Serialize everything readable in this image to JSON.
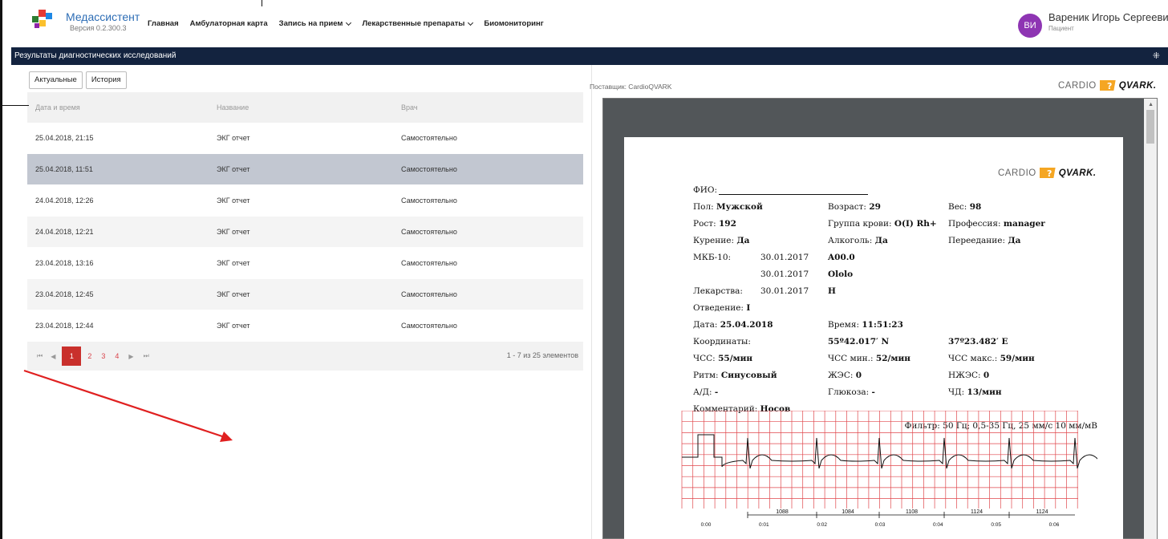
{
  "header": {
    "brand": "Медассистент",
    "version": "Версия 0.2.300.3",
    "nav": [
      {
        "label": "Главная",
        "has_dropdown": false
      },
      {
        "label": "Амбулаторная карта",
        "has_dropdown": false
      },
      {
        "label": "Запись на прием",
        "has_dropdown": true
      },
      {
        "label": "Лекарственные препараты",
        "has_dropdown": true
      },
      {
        "label": "Биомониторинг",
        "has_dropdown": false
      }
    ],
    "user": {
      "initials": "ВИ",
      "name": "Вареник Игорь Сергеевич",
      "role": "Пациент",
      "avatar_color": "#8e35b3"
    }
  },
  "panel_title": "Результаты диагностических исследований",
  "tabs": [
    {
      "label": "Актуальные"
    },
    {
      "label": "История"
    }
  ],
  "table": {
    "columns": [
      "Дата и время",
      "Название",
      "Врач"
    ],
    "rows": [
      {
        "datetime": "25.04.2018, 21:15",
        "name": "ЭКГ отчет",
        "doctor": "Самостоятельно"
      },
      {
        "datetime": "25.04.2018, 11:51",
        "name": "ЭКГ отчет",
        "doctor": "Самостоятельно",
        "selected": true
      },
      {
        "datetime": "24.04.2018, 12:26",
        "name": "ЭКГ отчет",
        "doctor": "Самостоятельно"
      },
      {
        "datetime": "24.04.2018, 12:21",
        "name": "ЭКГ отчет",
        "doctor": "Самостоятельно"
      },
      {
        "datetime": "23.04.2018, 13:16",
        "name": "ЭКГ отчет",
        "doctor": "Самостоятельно"
      },
      {
        "datetime": "23.04.2018, 12:45",
        "name": "ЭКГ отчет",
        "doctor": "Самостоятельно"
      },
      {
        "datetime": "23.04.2018, 12:44",
        "name": "ЭКГ отчет",
        "doctor": "Самостоятельно"
      }
    ]
  },
  "pager": {
    "pages": [
      "1",
      "2",
      "3",
      "4"
    ],
    "current": "1",
    "info": "1 - 7 из 25 элементов",
    "first_icon": "first-page-icon",
    "prev_icon": "prev-page-icon",
    "next_icon": "next-page-icon",
    "last_icon": "last-page-icon"
  },
  "report": {
    "provider": "Поставщик: CardioQVARK",
    "logo_left": "CARDIO",
    "logo_right": "QVARK.",
    "logo_accent": "#f5a623",
    "fio_label": "ФИО:",
    "sex_label": "Пол:",
    "sex": "Мужской",
    "age_label": "Возраст:",
    "age": "29",
    "weight_label": "Вес:",
    "weight": "98",
    "height_label": "Рост:",
    "height": "192",
    "blood_label": "Группа крови:",
    "blood": "O(I) Rh+",
    "job_label": "Профессия:",
    "job": "manager",
    "smoking_label": "Курение:",
    "smoking": "Да",
    "alcohol_label": "Алкоголь:",
    "alcohol": "Да",
    "overeat_label": "Переедание:",
    "overeat": "Да",
    "mkb_label": "МКБ-10:",
    "mkb": [
      {
        "date": "30.01.2017",
        "code": "A00.0"
      },
      {
        "date": "30.01.2017",
        "code": "Ololo"
      }
    ],
    "drugs_label": "Лекарства:",
    "drugs_date": "30.01.2017",
    "drugs": "H",
    "lead_label": "Отведение:",
    "lead": "I",
    "date_label": "Дата:",
    "date": "25.04.2018",
    "time_label": "Время:",
    "time": "11:51:23",
    "coords_label": "Координаты:",
    "lat": "55º42.017′ N",
    "lon": "37º23.482′ E",
    "hr_label": "ЧСС:",
    "hr": "55/мин",
    "hr_min_label": "ЧСС мин.:",
    "hr_min": "52/мин",
    "hr_max_label": "ЧСС макс.:",
    "hr_max": "59/мин",
    "rhythm_label": "Ритм:",
    "rhythm": "Синусовый",
    "pvc_label": "ЖЭС:",
    "pvc": "0",
    "svpc_label": "НЖЭС:",
    "svpc": "0",
    "bp_label": "А/Д:",
    "bp": "-",
    "glucose_label": "Глюкоза:",
    "glucose": "-",
    "rr_label": "ЧД:",
    "rr": "13/мин",
    "comment_label": "Комментарий:",
    "comment": "Носов",
    "filter": "Фильтр: 50 Гц; 0,5-35 Гц, 25 мм/с 10 мм/мВ",
    "rr_intervals": [
      "1088",
      "1084",
      "1108",
      "1124",
      "1124"
    ],
    "time_ticks": [
      "0:00",
      "0:01",
      "0:02",
      "0:03",
      "0:04",
      "0:05",
      "0:06"
    ],
    "grid_color": "#e0474c"
  }
}
